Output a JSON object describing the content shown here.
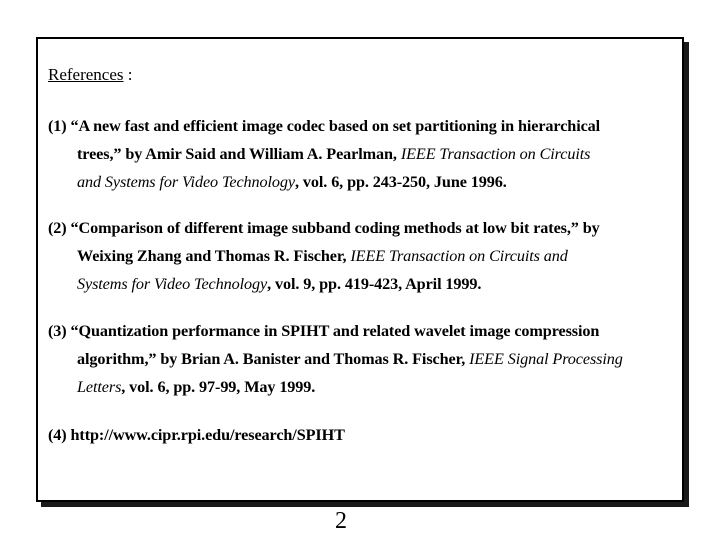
{
  "heading": {
    "label": "References",
    "suffix": " :"
  },
  "references": [
    {
      "lines": [
        {
          "parts": [
            {
              "text": "(1) “A new fast and efficient image codec based on set partitioning in hierarchical",
              "italic": false
            }
          ]
        },
        {
          "parts": [
            {
              "text": "trees,” by Amir Said and William A. Pearlman, ",
              "italic": false
            },
            {
              "text": "IEEE Transaction on Circuits",
              "italic": true
            }
          ]
        },
        {
          "parts": [
            {
              "text": "and Systems for Video Technology",
              "italic": true
            },
            {
              "text": ", vol. 6, pp. 243-250, June 1996.",
              "italic": false
            }
          ]
        }
      ]
    },
    {
      "lines": [
        {
          "parts": [
            {
              "text": "(2) “Comparison of different image subband coding methods at low bit rates,” by",
              "italic": false
            }
          ]
        },
        {
          "parts": [
            {
              "text": "Weixing Zhang and Thomas R. Fischer, ",
              "italic": false
            },
            {
              "text": "IEEE Transaction on Circuits and",
              "italic": true
            }
          ]
        },
        {
          "parts": [
            {
              "text": "Systems for Video Technology",
              "italic": true
            },
            {
              "text": ", vol. 9, pp. 419-423, April 1999.",
              "italic": false
            }
          ]
        }
      ]
    },
    {
      "lines": [
        {
          "parts": [
            {
              "text": "(3) “Quantization performance in SPIHT and related wavelet image compression",
              "italic": false
            }
          ]
        },
        {
          "parts": [
            {
              "text": "algorithm,” by Brian A. Banister and Thomas R. Fischer, ",
              "italic": false
            },
            {
              "text": "IEEE Signal Processing",
              "italic": true
            }
          ]
        },
        {
          "parts": [
            {
              "text": "Letters",
              "italic": true
            },
            {
              "text": ", vol. 6, pp. 97-99, May 1999.",
              "italic": false
            }
          ]
        }
      ]
    },
    {
      "lines": [
        {
          "parts": [
            {
              "text": "(4) http://www.cipr.rpi.edu/research/SPIHT",
              "italic": false
            }
          ]
        }
      ]
    }
  ],
  "page_number": "2"
}
